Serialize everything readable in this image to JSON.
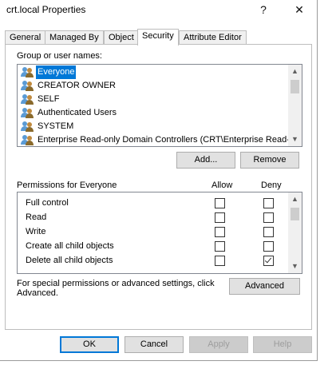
{
  "window": {
    "title": "crt.local Properties",
    "help_glyph": "?",
    "close_glyph": "✕"
  },
  "tabs": [
    {
      "label": "General"
    },
    {
      "label": "Managed By"
    },
    {
      "label": "Object"
    },
    {
      "label": "Security"
    },
    {
      "label": "Attribute Editor"
    }
  ],
  "security": {
    "group_label": "Group or user names:",
    "users": [
      {
        "name": "Everyone",
        "selected": true
      },
      {
        "name": "CREATOR OWNER"
      },
      {
        "name": "SELF"
      },
      {
        "name": "Authenticated Users"
      },
      {
        "name": "SYSTEM"
      },
      {
        "name": "Enterprise Read-only Domain Controllers (CRT\\Enterprise Read-..."
      }
    ],
    "add_button": "Add...",
    "remove_button": "Remove",
    "permissions_label": "Permissions for Everyone",
    "allow_header": "Allow",
    "deny_header": "Deny",
    "permissions": [
      {
        "name": "Full control",
        "allow": false,
        "deny": false
      },
      {
        "name": "Read",
        "allow": false,
        "deny": false
      },
      {
        "name": "Write",
        "allow": false,
        "deny": false
      },
      {
        "name": "Create all child objects",
        "allow": false,
        "deny": false
      },
      {
        "name": "Delete all child objects",
        "allow": false,
        "deny": true
      }
    ],
    "advanced_text": "For special permissions or advanced settings, click Advanced.",
    "advanced_button": "Advanced"
  },
  "footer": {
    "ok": "OK",
    "cancel": "Cancel",
    "apply": "Apply",
    "help": "Help"
  },
  "colors": {
    "selection": "#0078d7",
    "default_border": "#0078d7"
  }
}
